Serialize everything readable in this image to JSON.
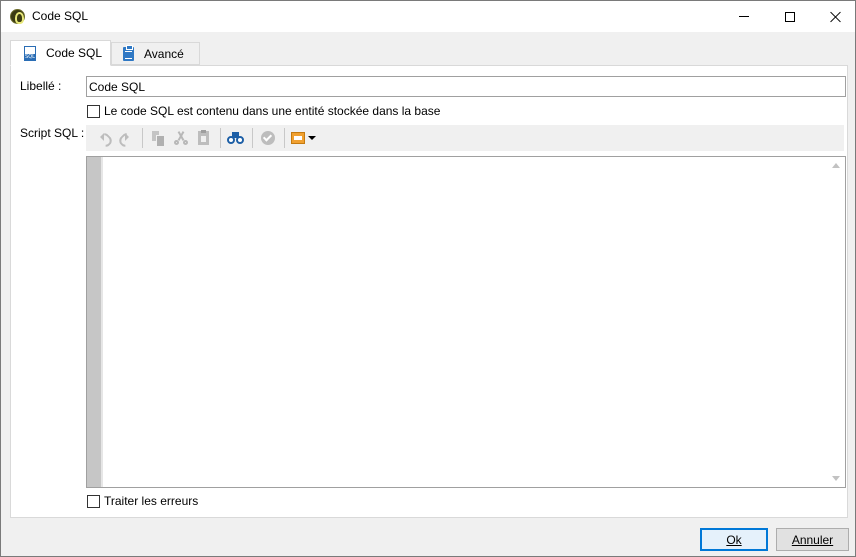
{
  "window": {
    "title": "Code SQL",
    "icon": "adobe-campaign-app-icon"
  },
  "tabs": [
    {
      "label": "Code SQL",
      "icon": "sql-file-icon",
      "active": true
    },
    {
      "label": "Avancé",
      "icon": "clipboard-icon",
      "active": false
    }
  ],
  "form": {
    "libelle_label": "Libellé :",
    "libelle_value": "Code SQL",
    "stored_checkbox_label": "Le code SQL est contenu dans une entité stockée dans la base",
    "stored_checked": false,
    "script_label": "Script SQL :",
    "script_value": "",
    "errors_checkbox_label": "Traiter les erreurs",
    "errors_checked": false
  },
  "toolbar": [
    {
      "name": "undo",
      "icon": "undo-icon",
      "enabled": false
    },
    {
      "name": "redo",
      "icon": "redo-icon",
      "enabled": false
    },
    {
      "name": "copy",
      "icon": "copy-icon",
      "enabled": false
    },
    {
      "name": "cut",
      "icon": "cut-icon",
      "enabled": false
    },
    {
      "name": "paste",
      "icon": "paste-icon",
      "enabled": false
    },
    {
      "name": "find",
      "icon": "binoculars-icon",
      "enabled": true
    },
    {
      "name": "validate",
      "icon": "validate-icon",
      "enabled": false
    },
    {
      "name": "insert-field",
      "icon": "fields-icon",
      "enabled": true
    }
  ],
  "buttons": {
    "ok": "Ok",
    "cancel": "Annuler"
  },
  "colors": {
    "accent": "#0078d7",
    "find_icon": "#1d5fa6",
    "fields_icon": "#f0a030"
  }
}
